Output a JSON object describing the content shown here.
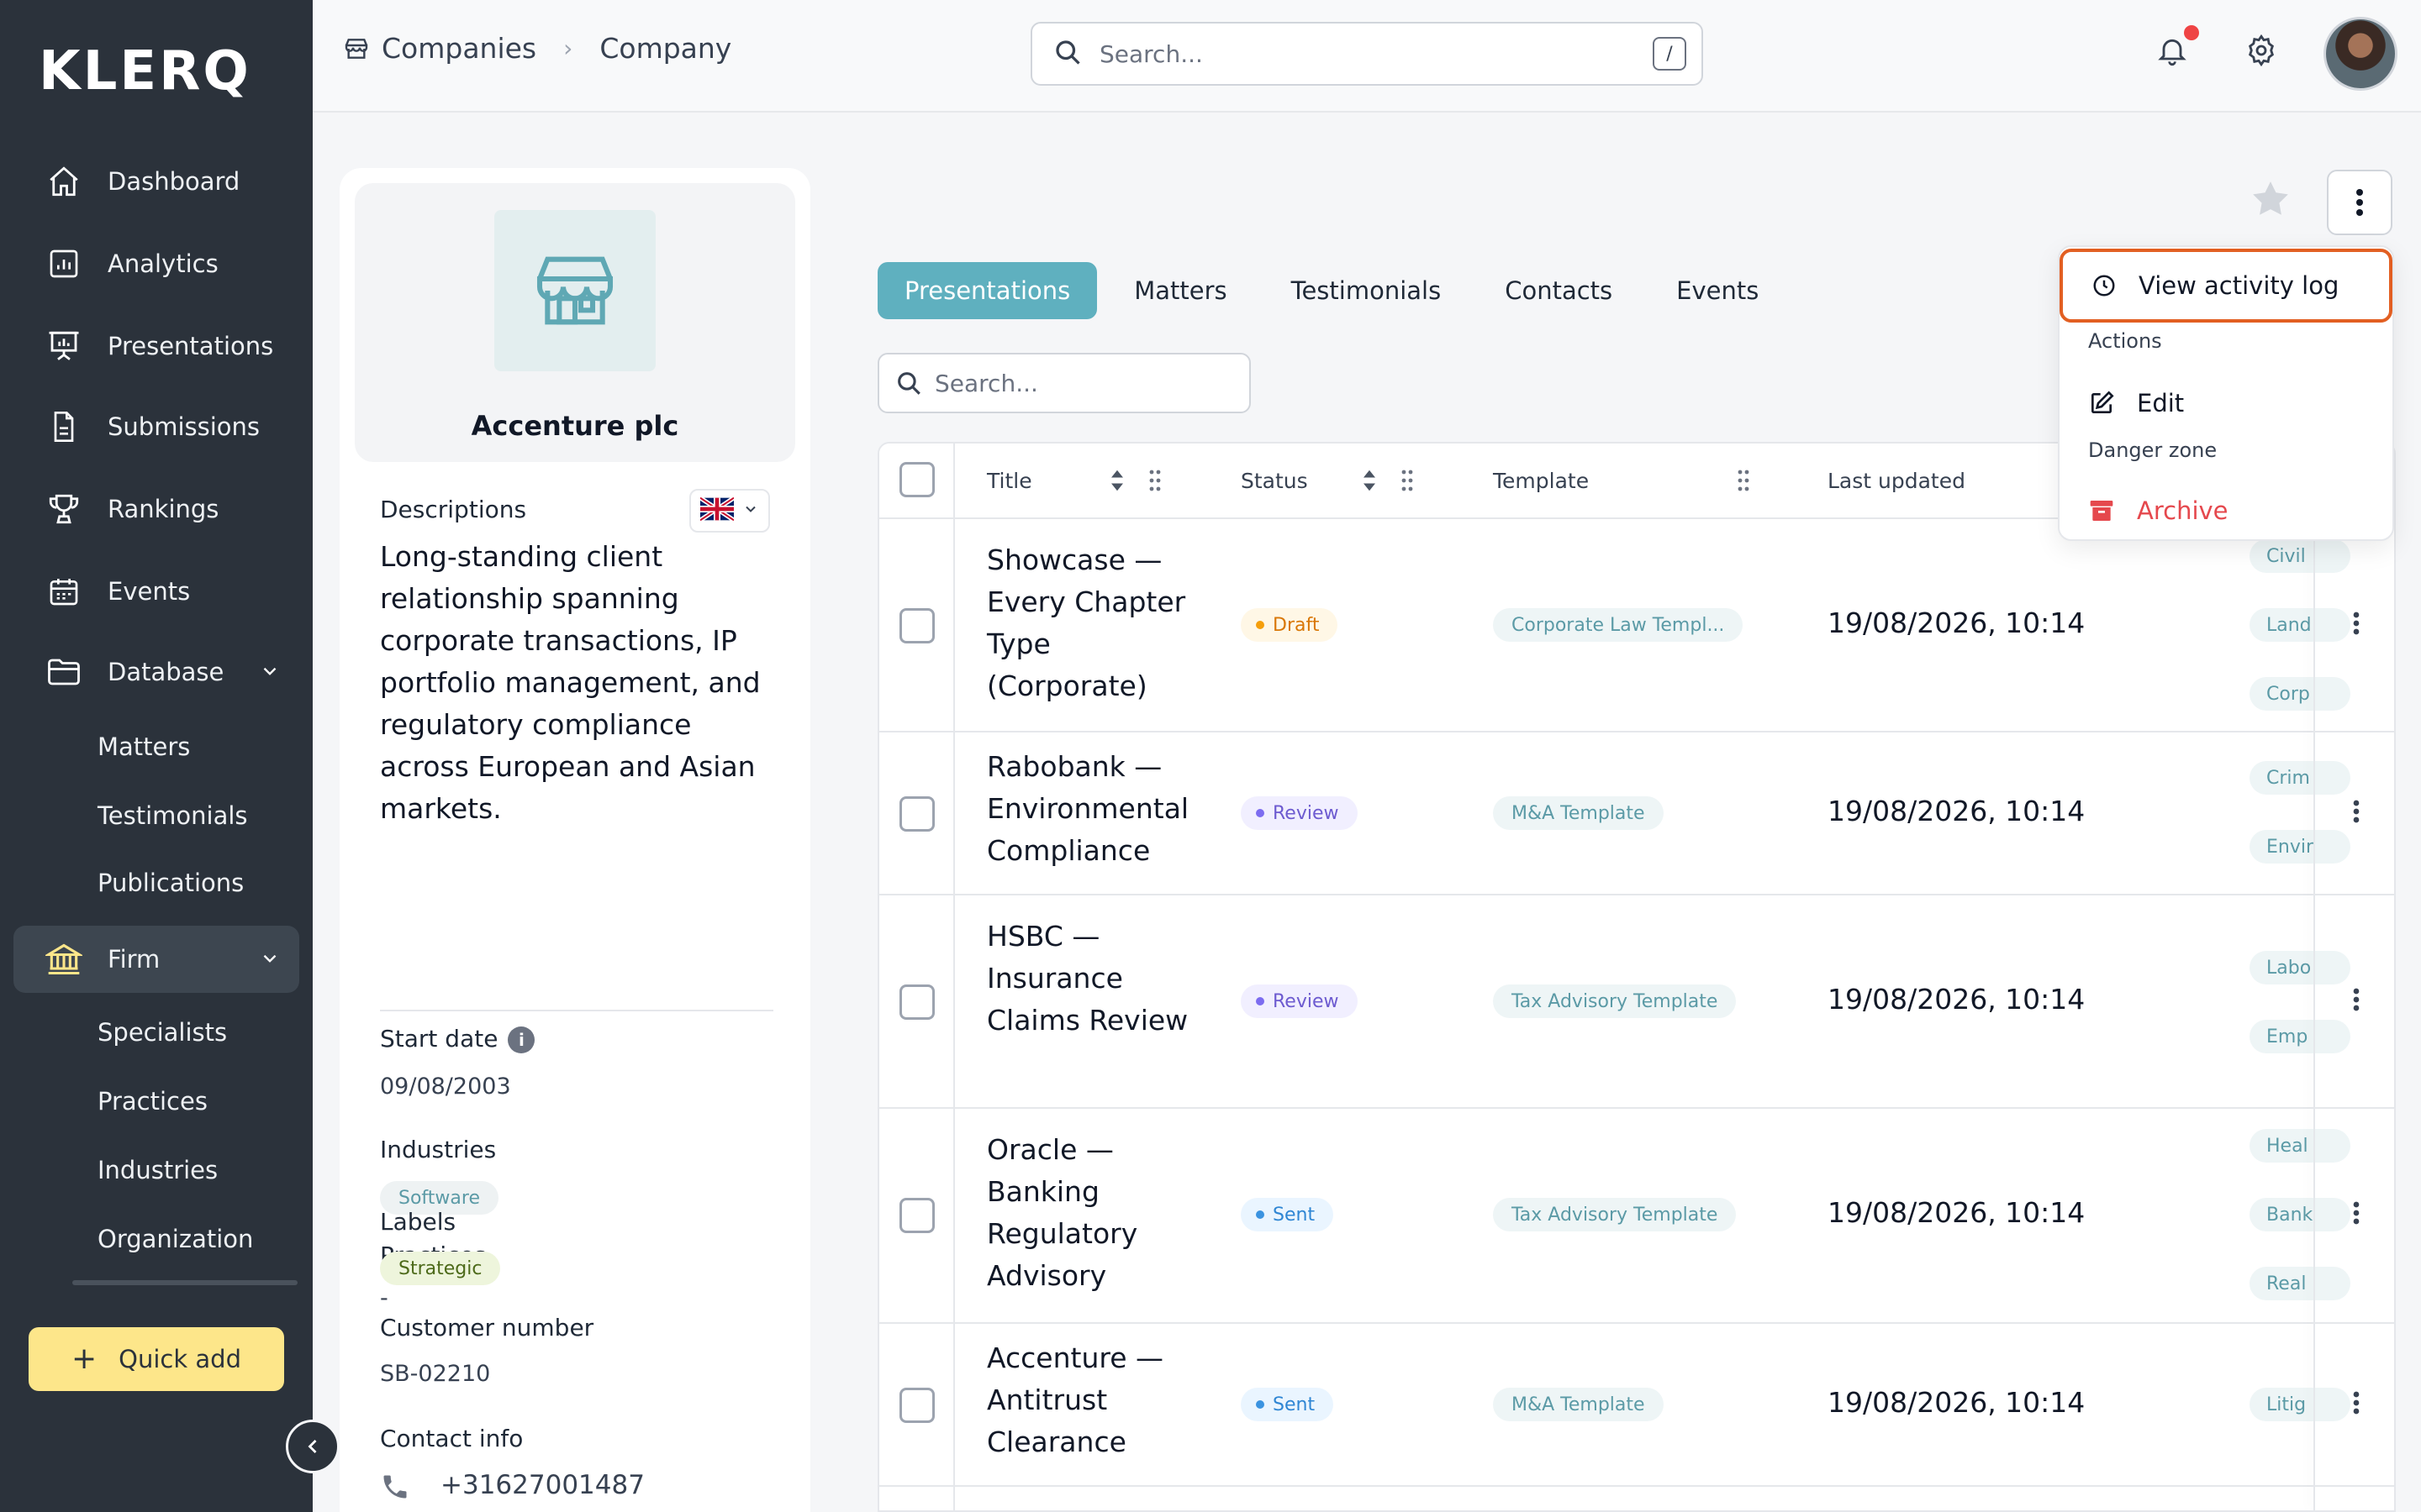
{
  "brand": {
    "logo": "KLERQ"
  },
  "sidebar": {
    "items": [
      {
        "label": "Dashboard",
        "icon": "home-icon"
      },
      {
        "label": "Analytics",
        "icon": "analytics-icon"
      },
      {
        "label": "Presentations",
        "icon": "presentation-icon"
      },
      {
        "label": "Submissions",
        "icon": "document-icon"
      },
      {
        "label": "Rankings",
        "icon": "trophy-icon"
      },
      {
        "label": "Events",
        "icon": "calendar-icon"
      },
      {
        "label": "Database",
        "icon": "folder-icon"
      }
    ],
    "database_children": [
      "Matters",
      "Testimonials",
      "Publications"
    ],
    "firm": {
      "label": "Firm",
      "icon": "bank-icon"
    },
    "firm_children": [
      "Specialists",
      "Practices",
      "Industries",
      "Organization"
    ],
    "quick_add": "Quick add"
  },
  "topbar": {
    "breadcrumb": [
      "Companies",
      "Company"
    ],
    "search_placeholder": "Search...",
    "shortcut": "/"
  },
  "company": {
    "name": "Accenture plc",
    "descriptions_label": "Descriptions",
    "description": "Long-standing client relationship spanning corporate transactions, IP portfolio management, and regulatory compliance across European and Asian markets.",
    "start_date_label": "Start date",
    "start_date": "09/08/2003",
    "industries_label": "Industries",
    "industries": [
      "Software"
    ],
    "practices_label": "Practices",
    "practices": "-",
    "labels_label": "Labels",
    "labels": [
      "Strategic"
    ],
    "customer_number_label": "Customer number",
    "customer_number": "SB-02210",
    "contact_info_label": "Contact info",
    "phone": "+31627001487"
  },
  "tabs": [
    {
      "label": "Presentations",
      "active": true
    },
    {
      "label": "Matters",
      "active": false
    },
    {
      "label": "Testimonials",
      "active": false
    },
    {
      "label": "Contacts",
      "active": false
    },
    {
      "label": "Events",
      "active": false
    }
  ],
  "table": {
    "search_placeholder": "Search...",
    "columns": [
      "Title",
      "Status",
      "Template",
      "Last updated"
    ],
    "rows": [
      {
        "title": "Showcase — Every Chapter Type (Corporate)",
        "status": "Draft",
        "template": "Corporate Law Templ...",
        "updated": "19/08/2026, 10:14",
        "tags": [
          "Civil",
          "Land",
          "Corp"
        ]
      },
      {
        "title": "Rabobank — Environmental Compliance",
        "status": "Review",
        "template": "M&A Template",
        "updated": "19/08/2026, 10:14",
        "tags": [
          "Crim",
          "Envir"
        ]
      },
      {
        "title": "HSBC — Insurance Claims Review",
        "status": "Review",
        "template": "Tax Advisory Template",
        "updated": "19/08/2026, 10:14",
        "tags": [
          "Labo",
          "Emp"
        ]
      },
      {
        "title": "Oracle — Banking Regulatory Advisory",
        "status": "Sent",
        "template": "Tax Advisory Template",
        "updated": "19/08/2026, 10:14",
        "tags": [
          "Heal",
          "Bank",
          "Real"
        ]
      },
      {
        "title": "Accenture — Antitrust Clearance",
        "status": "Sent",
        "template": "M&A Template",
        "updated": "19/08/2026, 10:14",
        "tags": [
          "Litig"
        ]
      }
    ]
  },
  "menu": {
    "view_activity_log": "View activity log",
    "actions_label": "Actions",
    "edit": "Edit",
    "danger_zone_label": "Danger zone",
    "archive": "Archive"
  },
  "colors": {
    "sidebar_bg": "#2b323b",
    "accent": "#5fb0bf",
    "quick_add": "#fde68a",
    "focus_ring": "#e25f22",
    "danger": "#e5484d"
  }
}
